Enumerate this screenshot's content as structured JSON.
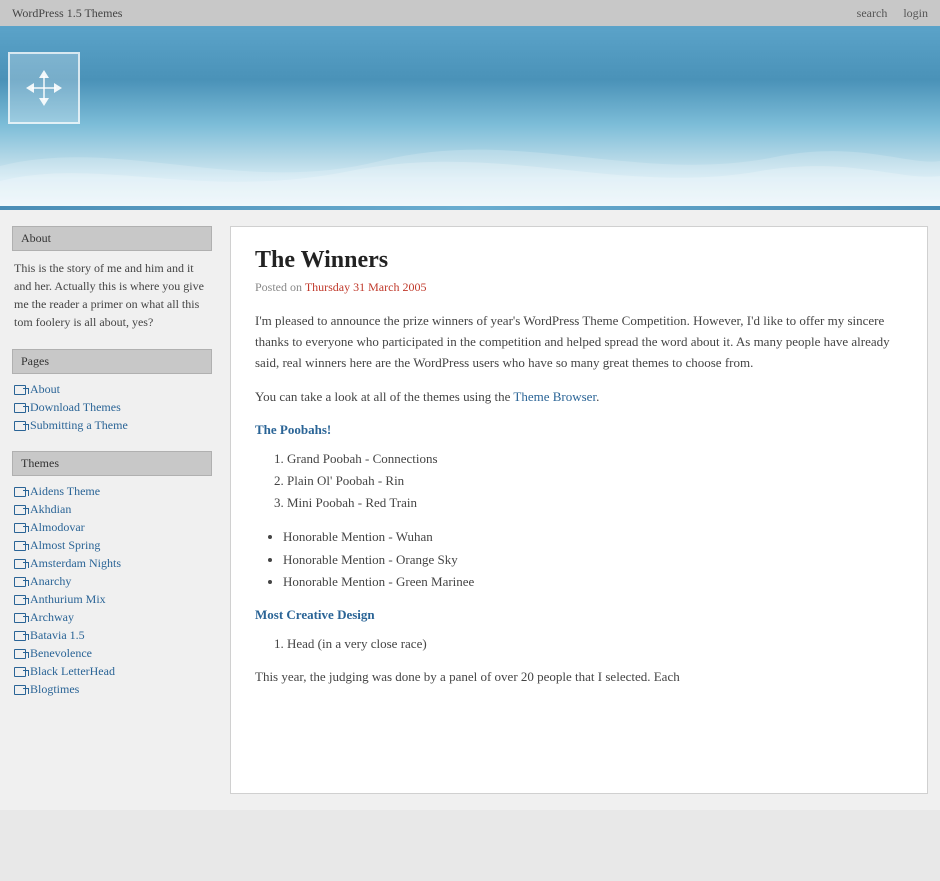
{
  "topbar": {
    "title": "WordPress 1.5 Themes",
    "search_label": "search",
    "login_label": "login"
  },
  "header": {
    "move_icon_title": "move"
  },
  "sidebar": {
    "about_heading": "About",
    "about_text": "This is the story of me and him and it and her. Actually this is where you give me the reader a primer on what all this tom foolery is all about, yes?",
    "pages_heading": "Pages",
    "pages_items": [
      {
        "label": "About",
        "href": "#"
      },
      {
        "label": "Download Themes",
        "href": "#"
      },
      {
        "label": "Submitting a Theme",
        "href": "#"
      }
    ],
    "themes_heading": "Themes",
    "themes_items": [
      {
        "label": "Aidens Theme",
        "href": "#"
      },
      {
        "label": "Akhdian",
        "href": "#"
      },
      {
        "label": "Almodovar",
        "href": "#"
      },
      {
        "label": "Almost Spring",
        "href": "#"
      },
      {
        "label": "Amsterdam Nights",
        "href": "#"
      },
      {
        "label": "Anarchy",
        "href": "#"
      },
      {
        "label": "Anthurium Mix",
        "href": "#"
      },
      {
        "label": "Archway",
        "href": "#"
      },
      {
        "label": "Batavia 1.5",
        "href": "#"
      },
      {
        "label": "Benevolence",
        "href": "#"
      },
      {
        "label": "Black LetterHead",
        "href": "#"
      },
      {
        "label": "Blogtimes",
        "href": "#"
      }
    ]
  },
  "article": {
    "title": "The Winners",
    "posted_prefix": "Posted on",
    "date": "Thursday 31 March 2005",
    "paragraphs": [
      "I'm pleased to announce the prize winners of year's WordPress Theme Competition. However, I'd like to offer my sincere thanks to everyone who participated in the competition and helped spread the word about it. As many people have already said, real winners here are the WordPress users who have so many great themes to choose from.",
      "You can take a look at all of the themes using the Theme Browser."
    ],
    "theme_browser_link_text": "Theme Browser",
    "poobahs_subheading": "The Poobahs!",
    "poobahs_ordered": [
      "Grand Poobah - Connections",
      "Plain Ol' Poobah - Rin",
      "Mini Poobah - Red Train"
    ],
    "poobahs_unordered": [
      "Honorable Mention - Wuhan",
      "Honorable Mention - Orange Sky",
      "Honorable Mention - Green Marinee"
    ],
    "creative_subheading": "Most Creative Design",
    "creative_ordered": [
      "Head (in a very close race)"
    ],
    "closing_text": "This year, the judging was done by a panel of over 20 people that I selected. Each"
  }
}
